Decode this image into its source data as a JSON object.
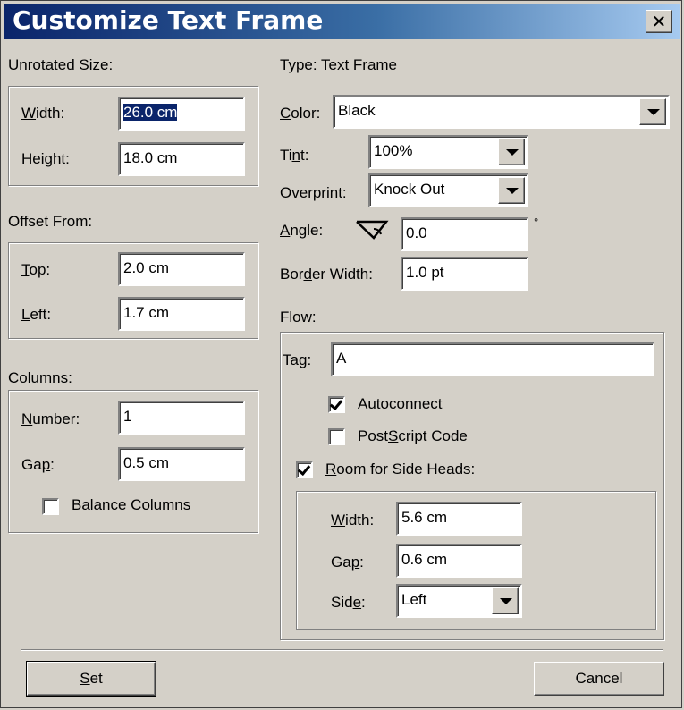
{
  "window": {
    "title": "Customize Text Frame",
    "close_label": "✕"
  },
  "unrotated_size": {
    "heading": "Unrotated Size:",
    "width_label": [
      "",
      "W",
      "idth:"
    ],
    "width_value": "26.0 cm",
    "height_label": [
      "",
      "H",
      "eight:"
    ],
    "height_value": "18.0 cm"
  },
  "offset_from": {
    "heading": "Offset From:",
    "top_label": [
      "",
      "T",
      "op:"
    ],
    "top_value": "2.0 cm",
    "left_label": [
      "",
      "L",
      "eft:"
    ],
    "left_value": "1.7 cm"
  },
  "columns": {
    "heading": "Columns:",
    "number_label": [
      "",
      "N",
      "umber:"
    ],
    "number_value": "1",
    "gap_label": [
      "Ga",
      "p",
      ":"
    ],
    "gap_value": "0.5 cm",
    "balance_label": [
      "",
      "B",
      "alance Columns"
    ],
    "balance_checked": false
  },
  "type": {
    "text": "Type: Text Frame"
  },
  "color": {
    "label": [
      "",
      "C",
      "olor:"
    ],
    "value": "Black"
  },
  "tint": {
    "label": [
      "Ti",
      "n",
      "t:"
    ],
    "value": "100%"
  },
  "overprint": {
    "label": [
      "",
      "O",
      "verprint:"
    ],
    "value": "Knock Out"
  },
  "angle": {
    "label": [
      "",
      "A",
      "ngle:"
    ],
    "value": "0.0",
    "unit": "°",
    "icon": "angle-icon"
  },
  "border_width": {
    "label": [
      "Bor",
      "d",
      "er Width:"
    ],
    "value": "1.0 pt"
  },
  "flow": {
    "heading": "Flow:",
    "tag_label": [
      "Ta",
      "g",
      ":"
    ],
    "tag_value": "A",
    "autoconnect_label": [
      "Auto",
      "c",
      "onnect"
    ],
    "autoconnect_checked": true,
    "postscript_label": [
      "Post",
      "S",
      "cript Code"
    ],
    "postscript_checked": false,
    "side_heads_label": [
      "",
      "R",
      "oom for Side Heads:"
    ],
    "side_heads_checked": true,
    "sh_width_label": [
      "",
      "W",
      "idth:"
    ],
    "sh_width_value": "5.6 cm",
    "sh_gap_label": [
      "Ga",
      "p",
      ":"
    ],
    "sh_gap_value": "0.6 cm",
    "sh_side_label": [
      "Sid",
      "e",
      ":"
    ],
    "sh_side_value": "Left"
  },
  "buttons": {
    "set": [
      "",
      "S",
      "et"
    ],
    "cancel": "Cancel"
  }
}
